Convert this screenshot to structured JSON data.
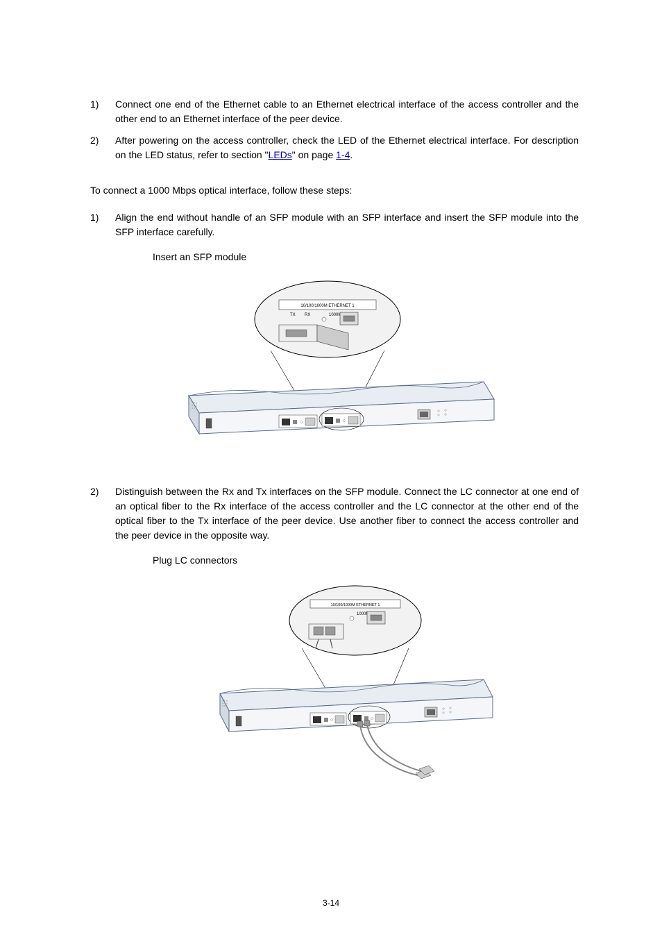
{
  "list1": {
    "items": [
      {
        "marker": "1)",
        "text": "Connect one end of the Ethernet cable to an Ethernet electrical interface of the access controller and the other end to an Ethernet interface of the peer device."
      },
      {
        "marker": "2)",
        "text_pre": "After powering on the access controller, check the LED of the Ethernet electrical interface. For description on the LED status, refer to section \"",
        "link1": "LEDs",
        "text_mid": "\" on page ",
        "link2": "1-4",
        "text_post": "."
      }
    ]
  },
  "intro": "To connect a 1000 Mbps optical interface, follow these steps:",
  "list2": {
    "items": [
      {
        "marker": "1)",
        "text": "Align the end without handle of an SFP module with an SFP interface and insert the SFP module into the SFP interface carefully."
      }
    ]
  },
  "figure1": {
    "caption": "Insert an SFP module",
    "module_label": "10/100/1000M ETHERNET 1",
    "tx": "TX",
    "rx": "RX",
    "speed": "1000M"
  },
  "list3": {
    "items": [
      {
        "marker": "2)",
        "text": "Distinguish between the Rx and Tx interfaces on the SFP module. Connect the LC connector at one end of an optical fiber to the Rx interface of the access controller and the LC connector at the other end of the optical fiber to the Tx interface of the peer device. Use another fiber to connect the access controller and the peer device in the opposite way."
      }
    ]
  },
  "figure2": {
    "caption": "Plug LC connectors",
    "module_label": "10/100/1000M ETHERNET 1",
    "speed": "1000M"
  },
  "page_number": "3-14"
}
